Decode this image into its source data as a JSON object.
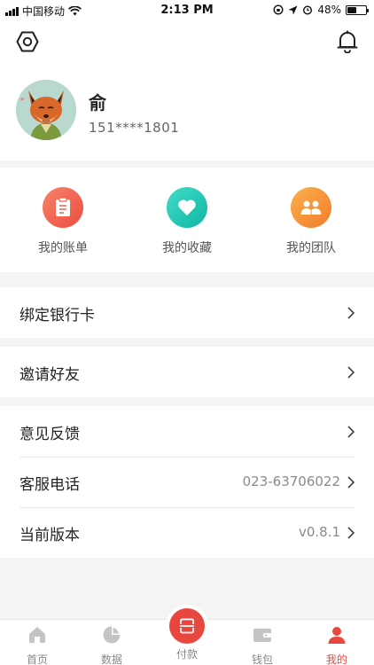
{
  "status_bar": {
    "carrier": "中国移动",
    "time": "2:13 PM",
    "battery": "48%",
    "battery_level": 0.48
  },
  "profile": {
    "name": "俞",
    "phone": "151****1801"
  },
  "quick_actions": [
    {
      "label": "我的账单",
      "icon": "bill-icon",
      "color": "#f0604c"
    },
    {
      "label": "我的收藏",
      "icon": "heart-icon",
      "color": "#1fc9b6"
    },
    {
      "label": "我的团队",
      "icon": "team-icon",
      "color": "#f5953b"
    }
  ],
  "menu": {
    "bind_card": "绑定银行卡",
    "invite": "邀请好友",
    "feedback": "意见反馈",
    "service_label": "客服电话",
    "service_value": "023-63706022",
    "version_label": "当前版本",
    "version_value": "v0.8.1"
  },
  "tabs": {
    "home": "首页",
    "data": "数据",
    "pay": "付款",
    "wallet": "钱包",
    "mine": "我的"
  },
  "colors": {
    "accent": "#e8473f"
  }
}
